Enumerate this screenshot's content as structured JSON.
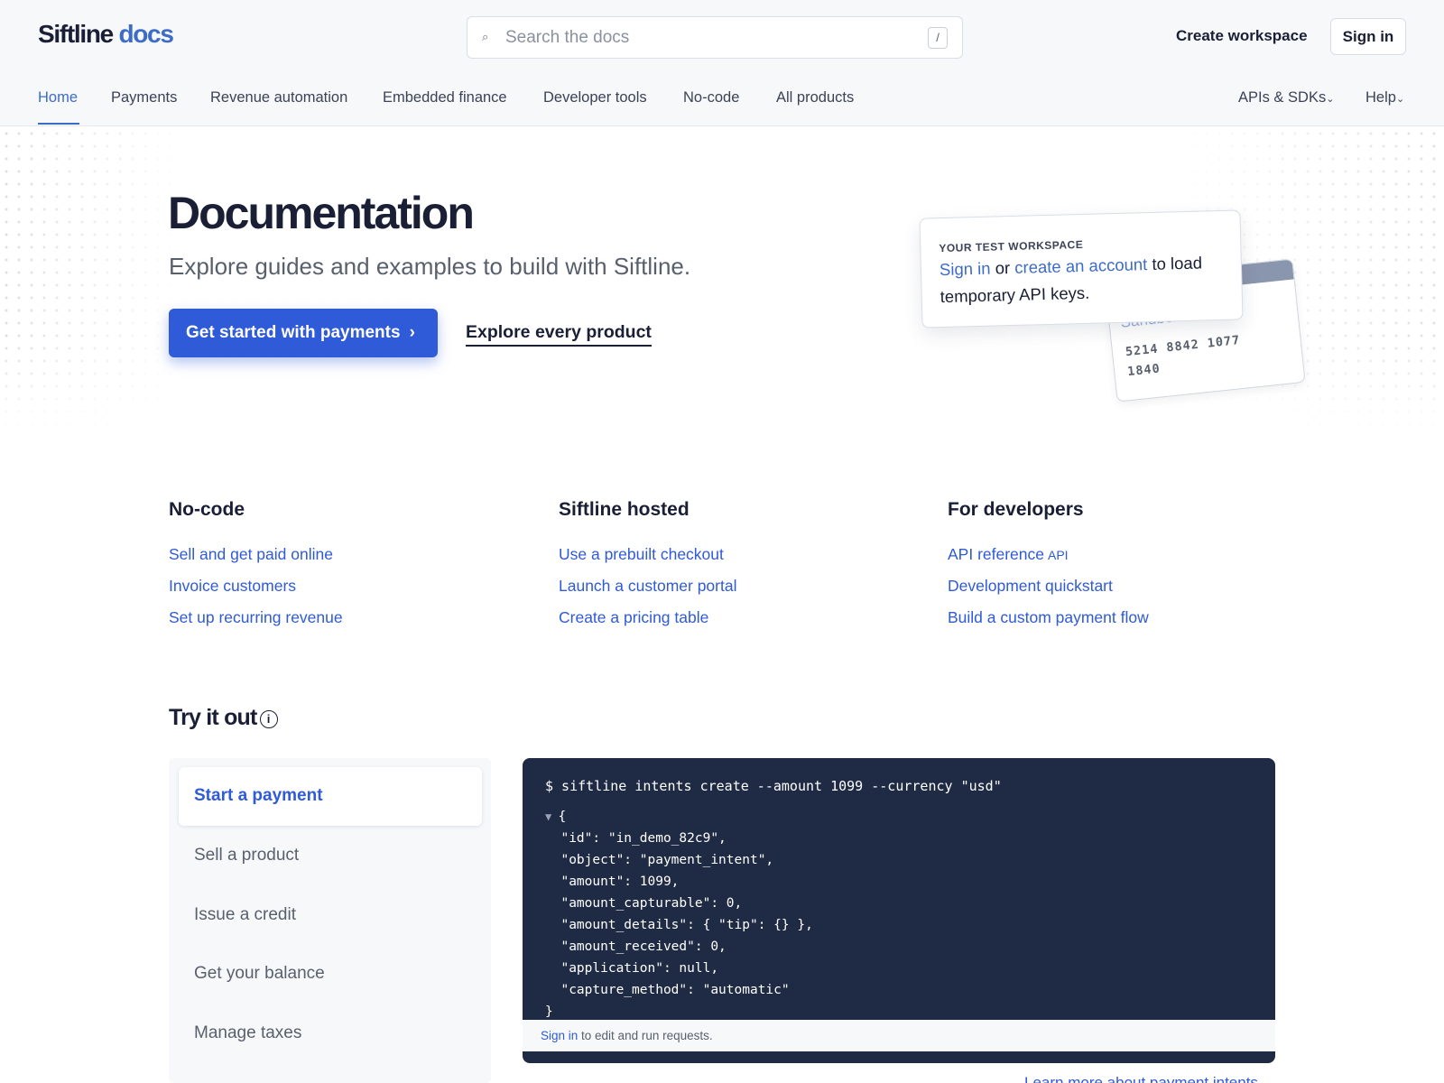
{
  "header": {
    "logo_brand": "Siftline",
    "logo_suffix": "docs",
    "search_placeholder": "Search the docs",
    "search_shortcut": "/",
    "create_workspace": "Create workspace",
    "sign_in": "Sign in"
  },
  "nav": {
    "items": [
      "Home",
      "Payments",
      "Revenue automation",
      "Embedded finance",
      "Developer tools",
      "No-code",
      "All products"
    ],
    "active": "Home",
    "right": [
      "APIs & SDKs",
      "Help"
    ]
  },
  "hero": {
    "title": "Documentation",
    "subtitle": "Explore guides and examples to build with Siftline.",
    "primary_cta": "Get started with payments",
    "secondary_cta": "Explore every product"
  },
  "workspace_card": {
    "heading": "YOUR TEST WORKSPACE",
    "sign_in": "Sign in",
    "or": " or ",
    "create_account": "create an account",
    "rest": " to load temporary API keys.",
    "card_label": "Sandbox card",
    "card_number": "5214 8842 1077 1840"
  },
  "columns": [
    {
      "heading": "No-code",
      "links": [
        "Sell and get paid online",
        "Invoice customers",
        "Set up recurring revenue"
      ]
    },
    {
      "heading": "Siftline hosted",
      "links": [
        "Use a prebuilt checkout",
        "Launch a customer portal",
        "Create a pricing table"
      ]
    },
    {
      "heading": "For developers",
      "links": [
        "API reference",
        "Development quickstart",
        "Build a custom payment flow"
      ],
      "badge": "API"
    }
  ],
  "try_it_out": {
    "heading": "Try it out",
    "items": [
      "Start a payment",
      "Sell a product",
      "Issue a credit",
      "Get your balance",
      "Manage taxes"
    ],
    "active": "Start a payment",
    "command": "$ siftline intents create --amount 1099 --currency \"usd\"",
    "response_lines": [
      "{",
      "  \"id\": \"in_demo_82c9\",",
      "  \"object\": \"payment_intent\",",
      "  \"amount\": 1099,",
      "  \"amount_capturable\": 0,",
      "  \"amount_details\": { \"tip\": {} },",
      "  \"amount_received\": 0,",
      "  \"application\": null,",
      "  \"capture_method\": \"automatic\"",
      "}"
    ],
    "footer_link": "Sign in",
    "footer_text": " to edit and run requests.",
    "bottom_link": "Learn more about payment intents"
  },
  "colors": {
    "accent": "#2f5ad8",
    "link": "#3d6bc9",
    "text": "#1a1f36",
    "code_bg": "#1f2a44"
  }
}
